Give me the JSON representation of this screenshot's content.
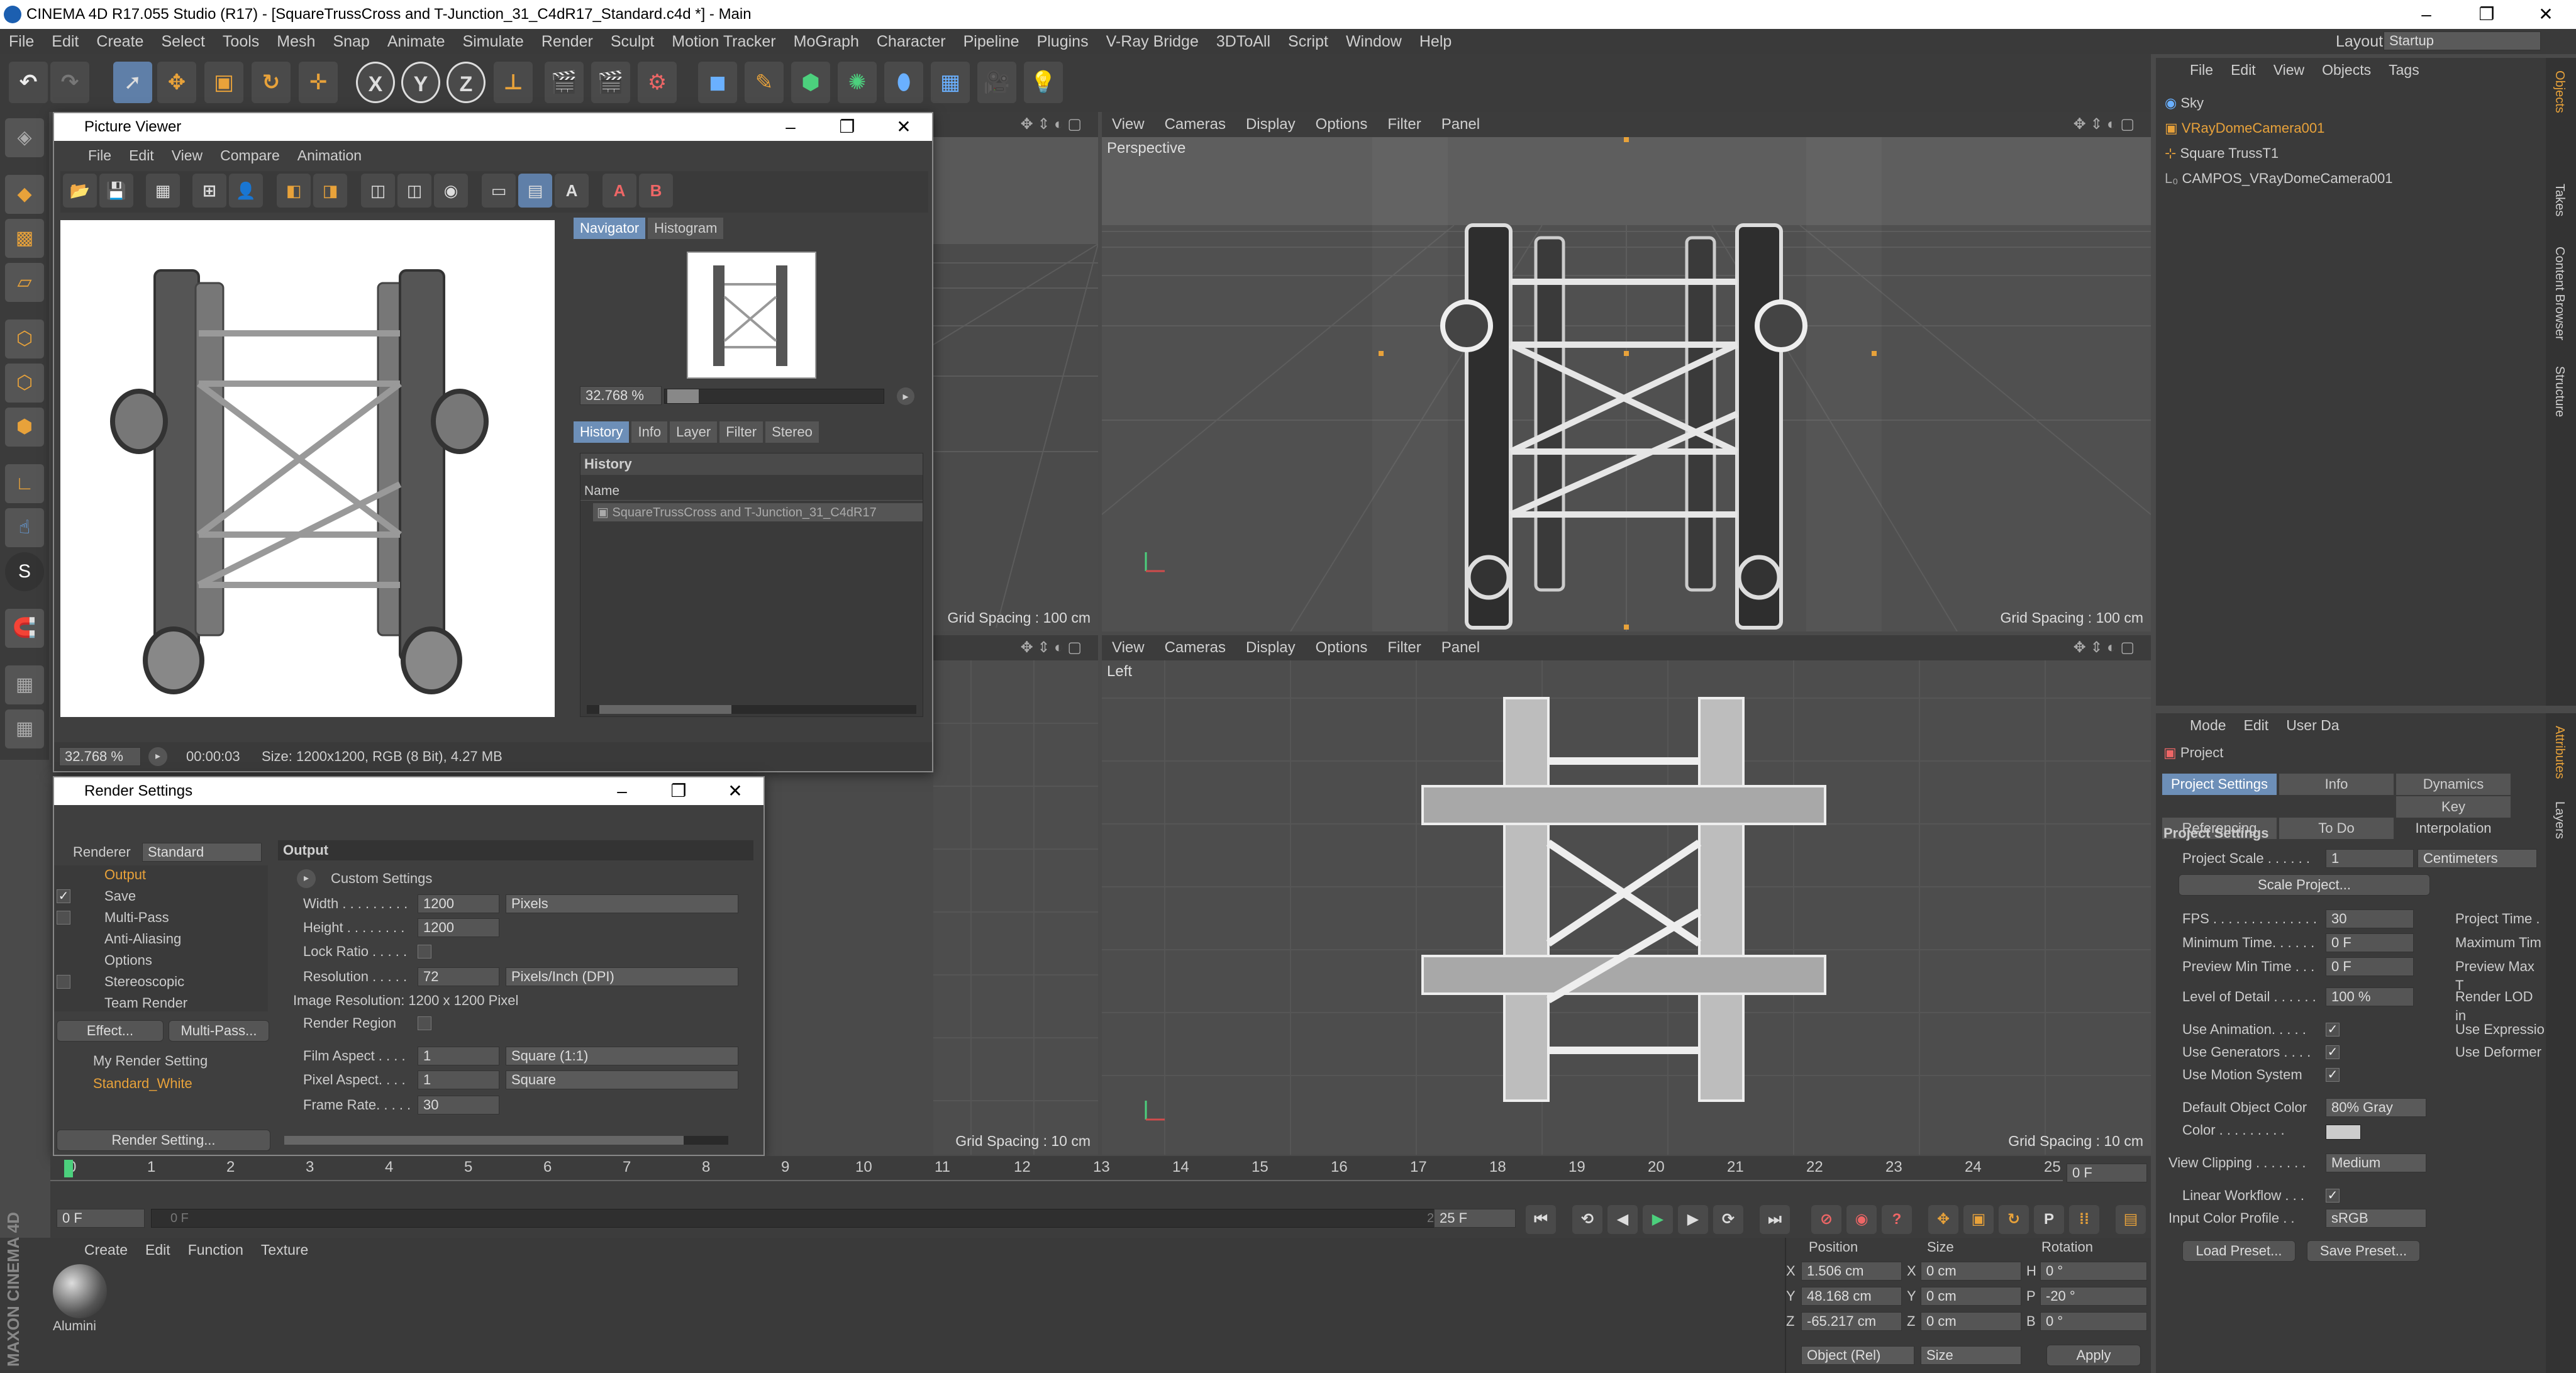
{
  "app": {
    "title": "CINEMA 4D R17.055 Studio (R17) - [SquareTrussCross and T-Junction_31_C4dR17_Standard.c4d *] - Main",
    "layout_label": "Layout:",
    "layout_value": "Startup",
    "window_controls": {
      "minimize": "–",
      "maximize": "❐",
      "close": "✕"
    }
  },
  "menu": [
    "File",
    "Edit",
    "Create",
    "Select",
    "Tools",
    "Mesh",
    "Snap",
    "Animate",
    "Simulate",
    "Render",
    "Sculpt",
    "Motion Tracker",
    "MoGraph",
    "Character",
    "Pipeline",
    "Plugins",
    "V-Ray Bridge",
    "3DToAll",
    "Script",
    "Window",
    "Help"
  ],
  "toolbar": {
    "x": "X",
    "y": "Y",
    "z": "Z"
  },
  "viewports": {
    "menu": [
      "View",
      "Cameras",
      "Display",
      "Options",
      "Filter",
      "Panel"
    ],
    "perspective": {
      "label": "Perspective",
      "grid": "Grid Spacing : 100 cm"
    },
    "top_left": {
      "grid": "Grid Spacing : 100 cm"
    },
    "left": {
      "label": "Left",
      "grid": "Grid Spacing : 10 cm"
    },
    "bottom_left": {
      "grid": "Grid Spacing : 10 cm"
    }
  },
  "picture_viewer": {
    "title": "Picture Viewer",
    "menu": [
      "File",
      "Edit",
      "View",
      "Compare",
      "Animation"
    ],
    "nav_tabs": [
      "Navigator",
      "Histogram"
    ],
    "zoom": "32.768 %",
    "hist_tabs": [
      "History",
      "Info",
      "Layer",
      "Filter",
      "Stereo"
    ],
    "history_header": "History",
    "name_col": "Name",
    "history_item": "SquareTrussCross and T-Junction_31_C4dR17",
    "status": {
      "zoom": "32.768 %",
      "time": "00:00:03",
      "info": "Size: 1200x1200, RGB (8 Bit), 4.27 MB"
    }
  },
  "render_settings": {
    "title": "Render Settings",
    "renderer_label": "Renderer",
    "renderer": "Standard",
    "tree": [
      "Output",
      "Save",
      "Multi-Pass",
      "Anti-Aliasing",
      "Options",
      "Stereoscopic",
      "Team Render"
    ],
    "effect_btn": "Effect...",
    "multipass_btn": "Multi-Pass...",
    "settings": [
      "My Render Setting",
      "Standard_White"
    ],
    "render_setting_btn": "Render Setting...",
    "section": "Output",
    "custom": "Custom Settings",
    "width_label": "Width . . . . . . . . .",
    "width": "1200",
    "units": "Pixels",
    "height_label": "Height . . . . . . . .",
    "height": "1200",
    "lock_label": "Lock Ratio . . . . .",
    "res_label": "Resolution . . . . .",
    "res": "72",
    "res_units": "Pixels/Inch (DPI)",
    "image_res": "Image Resolution: 1200 x 1200 Pixel",
    "region": "Render Region",
    "film_label": "Film Aspect . . . .",
    "film": "1",
    "film_sel": "Square (1:1)",
    "pixel_label": "Pixel Aspect. . . .",
    "pixel": "1",
    "pixel_sel": "Square",
    "frame_label": "Frame Rate. . . . .",
    "frame": "30"
  },
  "objects": {
    "menu": [
      "File",
      "Edit",
      "View",
      "Objects",
      "Tags"
    ],
    "items": [
      "Sky",
      "VRayDomeCamera001",
      "Square TrussT1",
      "CAMPOS_VRayDomeCamera001"
    ],
    "side_tabs": [
      "Objects",
      "Takes",
      "Content Browser",
      "Structure"
    ]
  },
  "attributes": {
    "menu": [
      "Mode",
      "Edit",
      "User Da"
    ],
    "project": "Project",
    "tabs": [
      "Project Settings",
      "Info",
      "Dynamics",
      "Referencing",
      "To Do",
      "Key Interpolation"
    ],
    "section": "Project Settings",
    "scale_label": "Project Scale . . . . . .",
    "scale": "1",
    "scale_unit": "Centimeters",
    "scale_btn": "Scale Project...",
    "fps_label": "FPS . . . . . . . . . . . . . .",
    "fps": "30",
    "ptime": "Project Time . . .",
    "mintime_label": "Minimum Time. . . . . .",
    "mintime": "0 F",
    "maxtime": "Maximum Tim",
    "pmin_label": "Preview Min Time . . .",
    "pmin": "0 F",
    "pmax": "Preview Max T",
    "lod_label": "Level of Detail . . . . . .",
    "lod": "100 %",
    "rlod": "Render LOD in",
    "useanim": "Use Animation. . . . .",
    "useexp": "Use Expressio",
    "usegen": "Use Generators . . . .",
    "usedef": "Use Deformer",
    "usemot": "Use Motion System",
    "defcol_label": "Default Object Color",
    "defcol": "80% Gray",
    "color_label": "Color . . . . . . . . .",
    "clip_label": "View Clipping . . . . . . .",
    "clip": "Medium",
    "linear": "Linear Workflow . . .",
    "profile_label": "Input Color Profile . .",
    "profile": "sRGB",
    "load_btn": "Load Preset...",
    "save_btn": "Save Preset...",
    "side_tabs": [
      "Attributes",
      "Layers"
    ]
  },
  "timeline": {
    "ticks": [
      "0",
      "1",
      "2",
      "3",
      "4",
      "5",
      "6",
      "7",
      "8",
      "9",
      "10",
      "11",
      "12",
      "13",
      "14",
      "15",
      "16",
      "17",
      "18",
      "19",
      "20",
      "21",
      "22",
      "23",
      "24",
      "25"
    ],
    "current": "0 F",
    "start": "0 F",
    "slider_start": "0 F",
    "slider_end": "25 F",
    "end": "25 F"
  },
  "materials": {
    "menu": [
      "Create",
      "Edit",
      "Function",
      "Texture"
    ],
    "item": "Alumini"
  },
  "coords": {
    "headers": [
      "Position",
      "Size",
      "Rotation"
    ],
    "px": "1.506 cm",
    "py": "48.168 cm",
    "pz": "-65.217 cm",
    "sx": "0 cm",
    "sy": "0 cm",
    "sz": "0 cm",
    "rh": "0 °",
    "rp": "-20 °",
    "rb": "0 °",
    "labels": {
      "x": "X",
      "y": "Y",
      "z": "Z",
      "h": "H",
      "p": "P",
      "b": "B"
    },
    "mode": "Object (Rel)",
    "size_mode": "Size",
    "apply": "Apply"
  },
  "maxon": "MAXON CINEMA 4D"
}
